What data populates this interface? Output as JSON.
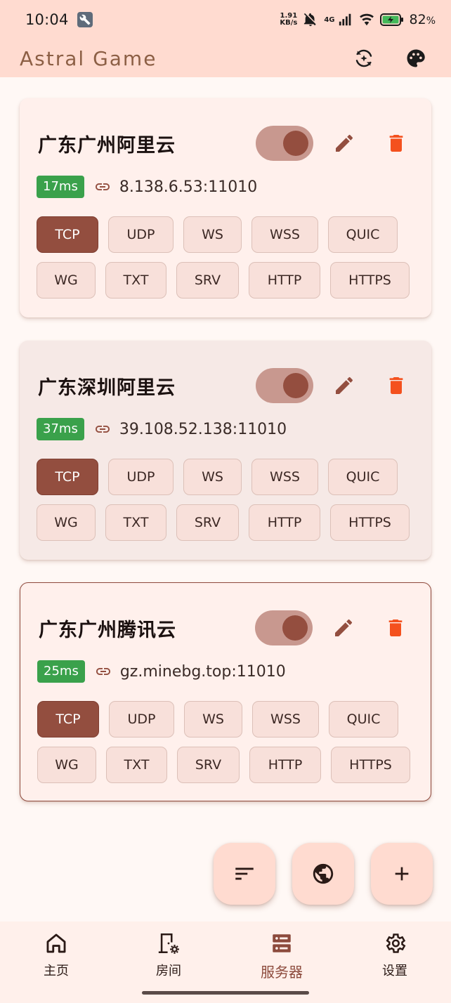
{
  "status_bar": {
    "time": "10:04",
    "net_speed_value": "1.91",
    "net_speed_unit": "KB/s",
    "network": "4G",
    "battery_pct": "82",
    "battery_suffix": "%"
  },
  "app_bar": {
    "title": "Astral Game",
    "actions": [
      {
        "icon": "sync-icon"
      },
      {
        "icon": "palette-icon"
      }
    ]
  },
  "servers": [
    {
      "name": "广东广州阿里云",
      "latency": "17ms",
      "address": "8.138.6.53:11010",
      "enabled": true,
      "protocols_row1": [
        "TCP",
        "UDP",
        "WS",
        "WSS",
        "QUIC"
      ],
      "protocols_row2": [
        "WG",
        "TXT",
        "SRV",
        "HTTP",
        "HTTPS"
      ],
      "active_protocol": "TCP"
    },
    {
      "name": "广东深圳阿里云",
      "latency": "37ms",
      "address": "39.108.52.138:11010",
      "enabled": true,
      "protocols_row1": [
        "TCP",
        "UDP",
        "WS",
        "WSS",
        "QUIC"
      ],
      "protocols_row2": [
        "WG",
        "TXT",
        "SRV",
        "HTTP",
        "HTTPS"
      ],
      "active_protocol": "TCP"
    },
    {
      "name": "广东广州腾讯云",
      "latency": "25ms",
      "address": "gz.minebg.top:11010",
      "enabled": true,
      "protocols_row1": [
        "TCP",
        "UDP",
        "WS",
        "WSS",
        "QUIC"
      ],
      "protocols_row2": [
        "WG",
        "TXT",
        "SRV",
        "HTTP",
        "HTTPS"
      ],
      "active_protocol": "TCP"
    }
  ],
  "fabs": [
    {
      "icon": "sort-icon"
    },
    {
      "icon": "globe-icon"
    },
    {
      "icon": "add-icon"
    }
  ],
  "bottom_nav": [
    {
      "label": "主页",
      "icon": "home-icon",
      "active": false
    },
    {
      "label": "房间",
      "icon": "room-settings-icon",
      "active": false
    },
    {
      "label": "服务器",
      "icon": "server-icon",
      "active": true
    },
    {
      "label": "设置",
      "icon": "gear-icon",
      "active": false
    }
  ],
  "colors": {
    "primary": "#934e3f",
    "surface": "#fff8f5",
    "container": "#ffdbd0",
    "latency_good": "#3aa14b",
    "delete": "#f4511e"
  }
}
